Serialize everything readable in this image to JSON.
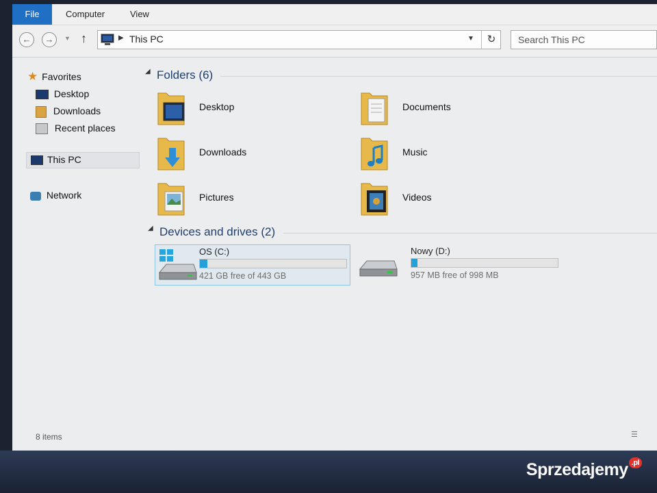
{
  "ribbon": {
    "tabs": [
      "File",
      "Computer",
      "View"
    ]
  },
  "address": {
    "path": "This PC",
    "search_placeholder": "Search This PC"
  },
  "nav": {
    "favorites_label": "Favorites",
    "favorites": [
      "Desktop",
      "Downloads",
      "Recent places"
    ],
    "this_pc": "This PC",
    "network": "Network"
  },
  "folders": {
    "header": "Folders (6)",
    "items": [
      "Desktop",
      "Documents",
      "Downloads",
      "Music",
      "Pictures",
      "Videos"
    ]
  },
  "devices": {
    "header": "Devices and drives (2)",
    "drives": [
      {
        "name": "OS (C:)",
        "free": "421 GB free of 443 GB",
        "used_fraction": 0.05
      },
      {
        "name": "Nowy (D:)",
        "free": "957 MB free of 998 MB",
        "used_fraction": 0.04
      }
    ]
  },
  "status": {
    "items": "8 items"
  },
  "watermark": {
    "text": "Sprzedajemy",
    "suffix": ".pl"
  },
  "colors": {
    "accent": "#1f6fc5",
    "drive_bar": "#26a0da",
    "header_text": "#1e3f6e"
  }
}
